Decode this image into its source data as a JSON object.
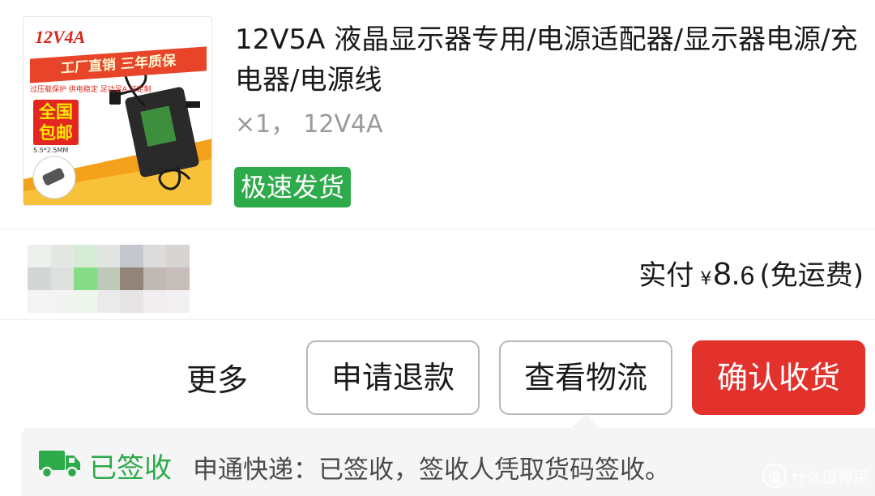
{
  "product": {
    "title": "12V5A 液晶显示器专用/电源适配器/显示器电源/充电器/电源线",
    "quantity": "×1，",
    "variant": "12V4A",
    "badge": "极速发货",
    "thumbnail": {
      "model": "12V4A",
      "slogan": "工厂直销 三年质保",
      "features": "过压载保护 供电稳定 足功足A 可定制",
      "shipping": "全国包邮",
      "size": "5.5*2.5MM"
    }
  },
  "payment": {
    "label": "实付",
    "currency": "¥",
    "amount_int": "8.",
    "amount_dec": "6",
    "note": "(免运费)"
  },
  "actions": {
    "more": "更多",
    "refund": "申请退款",
    "logistics": "查看物流",
    "confirm": "确认收货"
  },
  "tracking": {
    "status": "已签收",
    "message": "申通快递：已签收，签收人凭取货码签收。"
  },
  "watermark": {
    "logo": "值",
    "text": "什么值得买"
  },
  "colors": {
    "accent_green": "#2daa4a",
    "confirm_red": "#e2322b",
    "muted_text": "#9a9a9a"
  }
}
